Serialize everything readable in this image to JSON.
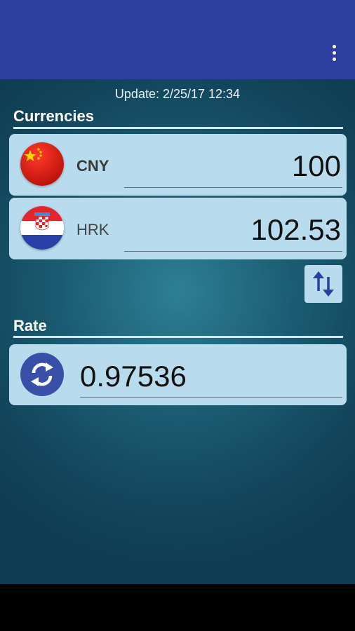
{
  "header": {
    "menu_icon": "more-vert-icon"
  },
  "update_text": "Update: 2/25/17 12:34",
  "currencies": {
    "title": "Currencies",
    "from": {
      "code": "CNY",
      "value": "100",
      "flag_icon": "china-flag-icon"
    },
    "to": {
      "code": "HRK",
      "value": "102.53",
      "flag_icon": "croatia-flag-icon"
    }
  },
  "swap_icon": "swap-vertical-icon",
  "rate": {
    "title": "Rate",
    "value": "0.97536",
    "icon": "refresh-icon"
  },
  "colors": {
    "appbar": "#2f3f9f",
    "card": "#b8dcee",
    "accent": "#3a4fa8",
    "background": "#1b5b71"
  }
}
